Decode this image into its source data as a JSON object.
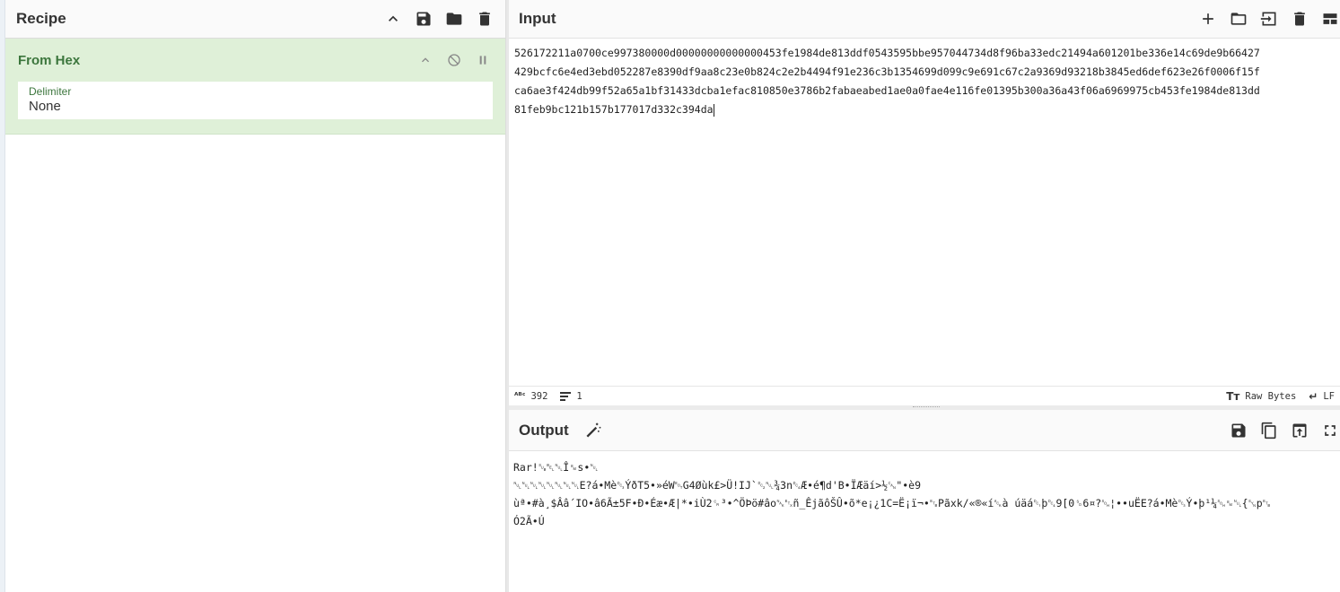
{
  "recipe": {
    "title": "Recipe",
    "operation": {
      "name": "From Hex",
      "field_label": "Delimiter",
      "field_value": "None"
    }
  },
  "input": {
    "title": "Input",
    "lines": [
      "526172211a0700ce997380000d00000000000000453fe1984de813ddf0543595bbe957044734d8f96ba33edc21494a601201be336e14c69de9b66427",
      "429bcfc6e4ed3ebd052287e8390df9aa8c23e0b824c2e2b4494f91e236c3b1354699d099c9e691c67c2a9369d93218b3845ed6def623e26f0006f15f",
      "ca6ae3f424db99f52a65a1bf31433dcba1efac810850e3786b2fabaeabed1ae0a0fae4e116fe01395b300a36a43f06a6969975cb453fe1984de813dd",
      "81feb9bc121b157b177017d332c394da"
    ],
    "status": {
      "length": "392",
      "lines": "1",
      "encoding": "Raw Bytes",
      "eol": "LF"
    }
  },
  "output": {
    "title": "Output",
    "lines": [
      "Rar!␚␇␀Î␙s•␀",
      "␀␀␀␀␀␀␀␀E?á•Mè␓ÝðT5•»éW␄G4Øùk£>Ü!IJ`␒␀¾3n␔Æ•é¶d'B•ÏÆäí>½␘\"•è9",
      "ùª•#à¸$Ââ´IO•â6Ã±5F•Ð•Éæ•Æ|*•iÙ2␍³•^ÖÞö#âo␕␃ñ_ÊjãôŠÛ•õ*e¡¿1C=Ë¡ï¬•␗Pãxk/«®«í␆à úäá␑þ␔9[0␎6¤?␁¦••uËE?á•Mè␓Ý•þ¹¼␁␙␀{␖p␗",
      "Ó2Ã•Ú"
    ]
  }
}
